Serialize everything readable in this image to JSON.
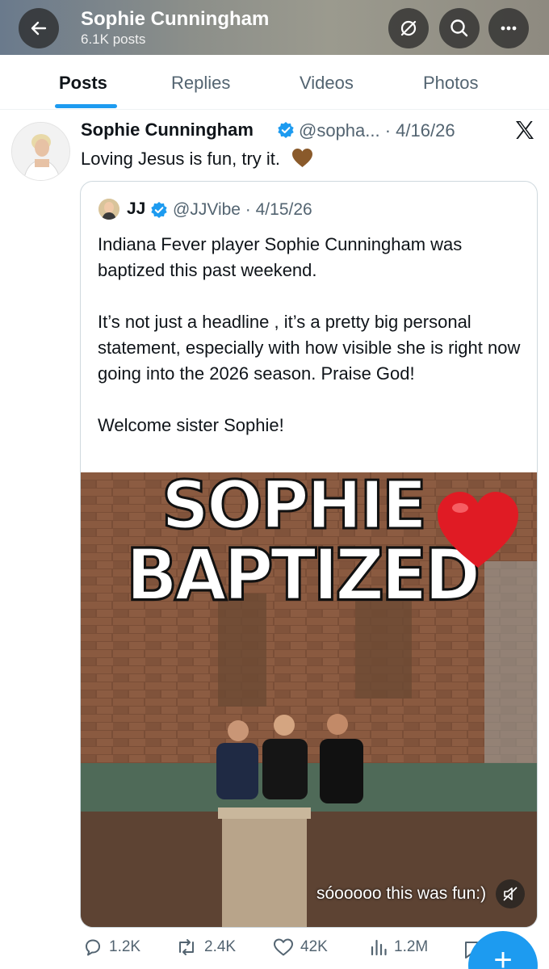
{
  "header": {
    "name": "Sophie Cunningham",
    "posts_count": "6.1K posts"
  },
  "tabs": [
    {
      "label": "Posts",
      "active": true
    },
    {
      "label": "Replies",
      "active": false
    },
    {
      "label": "Videos",
      "active": false
    },
    {
      "label": "Photos",
      "active": false
    }
  ],
  "post": {
    "author_name": "Sophie Cunningham",
    "handle_date": "@sopha... · 4/16/26",
    "text": "Loving Jesus is fun, try it."
  },
  "quote": {
    "author_name": "JJ",
    "handle_date": "@JJVibe · 4/15/26",
    "paragraphs": [
      "Indiana Fever player Sophie Cunningham was baptized this past weekend.",
      "It’s not just a headline , it’s a pretty big personal statement, especially with how visible she is right now going into the 2026 season. Praise God!",
      "Welcome sister Sophie!"
    ],
    "media": {
      "title_line1": "SOPHIE",
      "title_line2": "BAPTIZED",
      "caption": "sóooooo this was fun:)"
    }
  },
  "actions": {
    "replies": "1.2K",
    "reposts": "2.4K",
    "likes": "42K",
    "views": "1.2M"
  },
  "colors": {
    "accent": "#1d9bf0",
    "verified": "#1d9bf0",
    "secondary_text": "#536471"
  }
}
